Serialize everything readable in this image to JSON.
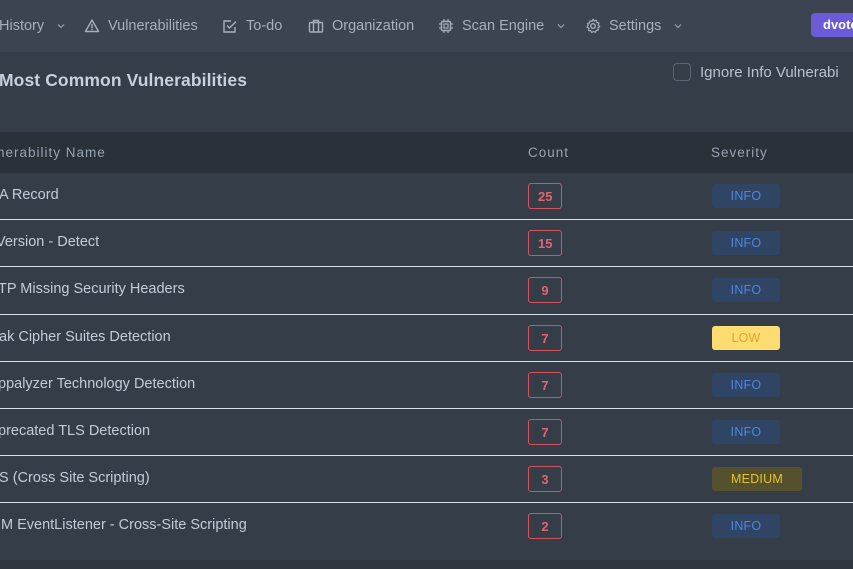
{
  "nav": {
    "items": [
      {
        "label": "History",
        "icon": "history-icon",
        "has_dropdown": true
      },
      {
        "label": "Vulnerabilities",
        "icon": "warning-triangle-icon",
        "has_dropdown": false
      },
      {
        "label": "To-do",
        "icon": "checkbox-pencil-icon",
        "has_dropdown": false
      },
      {
        "label": "Organization",
        "icon": "briefcase-icon",
        "has_dropdown": false
      },
      {
        "label": "Scan Engine",
        "icon": "cpu-chip-icon",
        "has_dropdown": true
      },
      {
        "label": "Settings",
        "icon": "gear-icon",
        "has_dropdown": true
      }
    ],
    "user_button": "dvote"
  },
  "card": {
    "title": "Most Common Vulnerabilities",
    "ignore_info_label": "Ignore Info Vulnerabi",
    "ignore_info_checked": false
  },
  "table": {
    "columns": [
      "nerability Name",
      "Count",
      "Severity"
    ],
    "rows": [
      {
        "name": "A Record",
        "count": "25",
        "severity": "INFO"
      },
      {
        "name": "Version - Detect",
        "count": "15",
        "severity": "INFO"
      },
      {
        "name": "TP Missing Security Headers",
        "count": "9",
        "severity": "INFO"
      },
      {
        "name": "ak Cipher Suites Detection",
        "count": "7",
        "severity": "LOW"
      },
      {
        "name": "ppalyzer Technology Detection",
        "count": "7",
        "severity": "INFO"
      },
      {
        "name": "precated TLS Detection",
        "count": "7",
        "severity": "INFO"
      },
      {
        "name": "S (Cross Site Scripting)",
        "count": "3",
        "severity": "MEDIUM"
      },
      {
        "name": "M EventListener - Cross-Site Scripting",
        "count": "2",
        "severity": "INFO"
      }
    ]
  },
  "colors": {
    "nav_bg": "#3b4450",
    "card_bg": "#353d48",
    "accent": "#6c5bd9",
    "count_border": "#d3545d",
    "info_bg": "#2f4563",
    "info_text": "#4d86e0",
    "low_bg": "#ffdc72",
    "medium_bg": "#55512f"
  }
}
